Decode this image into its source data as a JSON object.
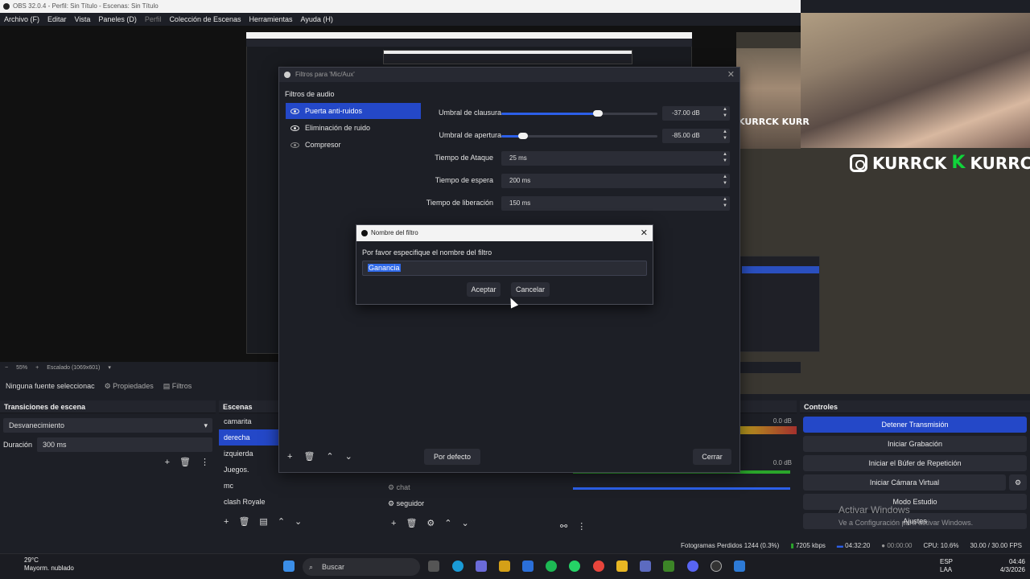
{
  "window": {
    "title": "OBS 32.0.4 - Perfil: Sin Título - Escenas: Sin Título"
  },
  "menu": [
    "Archivo (F)",
    "Editar",
    "Vista",
    "Paneles (D)",
    "Perfil",
    "Colección de Escenas",
    "Herramientas",
    "Ayuda (H)"
  ],
  "overlay": {
    "brand": "KURRCK",
    "brand_small": "KURRCK  KURR"
  },
  "zoom": {
    "percent": "55%",
    "scale": "Escalado (1069x601)"
  },
  "source_toolbar": {
    "none_selected": "Ninguna fuente seleccionac",
    "properties": "Propiedades",
    "filters": "Filtros"
  },
  "transitions": {
    "header": "Transiciones de escena",
    "type": "Desvanecimiento",
    "duration_label": "Duración",
    "duration_value": "300 ms"
  },
  "scenes": {
    "header": "Escenas",
    "items": [
      "camarita",
      "derecha",
      "izquierda",
      "Juegos.",
      "mc",
      "clash Royale"
    ],
    "selected": 1
  },
  "sources": {
    "items": [
      "chat",
      "seguidor"
    ]
  },
  "mixer": {
    "db1": "0.0 dB",
    "db2": "0.0 dB"
  },
  "controls": {
    "header": "Controles",
    "buttons": [
      "Detener Transmisión",
      "Iniciar Grabación",
      "Iniciar el Búfer de Repetición",
      "Iniciar Cámara Virtual",
      "Modo Estudio",
      "Ajustes"
    ]
  },
  "filters_dialog": {
    "title": "Filtros para 'Mic/Aux'",
    "section": "Filtros de audio",
    "filters": [
      "Puerta anti-ruidos",
      "Eliminación de ruido",
      "Compresor"
    ],
    "props": {
      "close_threshold_label": "Umbral de clausura",
      "close_threshold_value": "-37.00 dB",
      "close_threshold_level": 0.62,
      "open_threshold_label": "Umbral de apertura",
      "open_threshold_value": "-85.00 dB",
      "open_threshold_level": 0.14,
      "attack_label": "Tiempo de Ataque",
      "attack_value": "25 ms",
      "hold_label": "Tiempo de espera",
      "hold_value": "200 ms",
      "release_label": "Tiempo de liberación",
      "release_value": "150 ms"
    },
    "default_button": "Por defecto",
    "close_button": "Cerrar"
  },
  "name_dialog": {
    "title": "Nombre del filtro",
    "prompt": "Por favor especifique el nombre del filtro",
    "value": "Ganancia",
    "accept": "Aceptar",
    "cancel": "Cancelar"
  },
  "watermark": {
    "line1": "Activar Windows",
    "line2": "Ve a Configuración para activar Windows."
  },
  "status": {
    "dropped": "Fotogramas Perdidos 1244 (0.3%)",
    "bitrate": "7205 kbps",
    "stream_time": "04:32:20",
    "rec_time": "00:00:00",
    "cpu": "CPU: 10.6%",
    "fps": "30.00 / 30.00 FPS"
  },
  "taskbar": {
    "weather_temp": "29°C",
    "weather_desc": "Mayorm. nublado",
    "search": "Buscar",
    "lang1": "ESP",
    "lang2": "LAA",
    "time": "04:46",
    "date": "4/3/2026"
  }
}
